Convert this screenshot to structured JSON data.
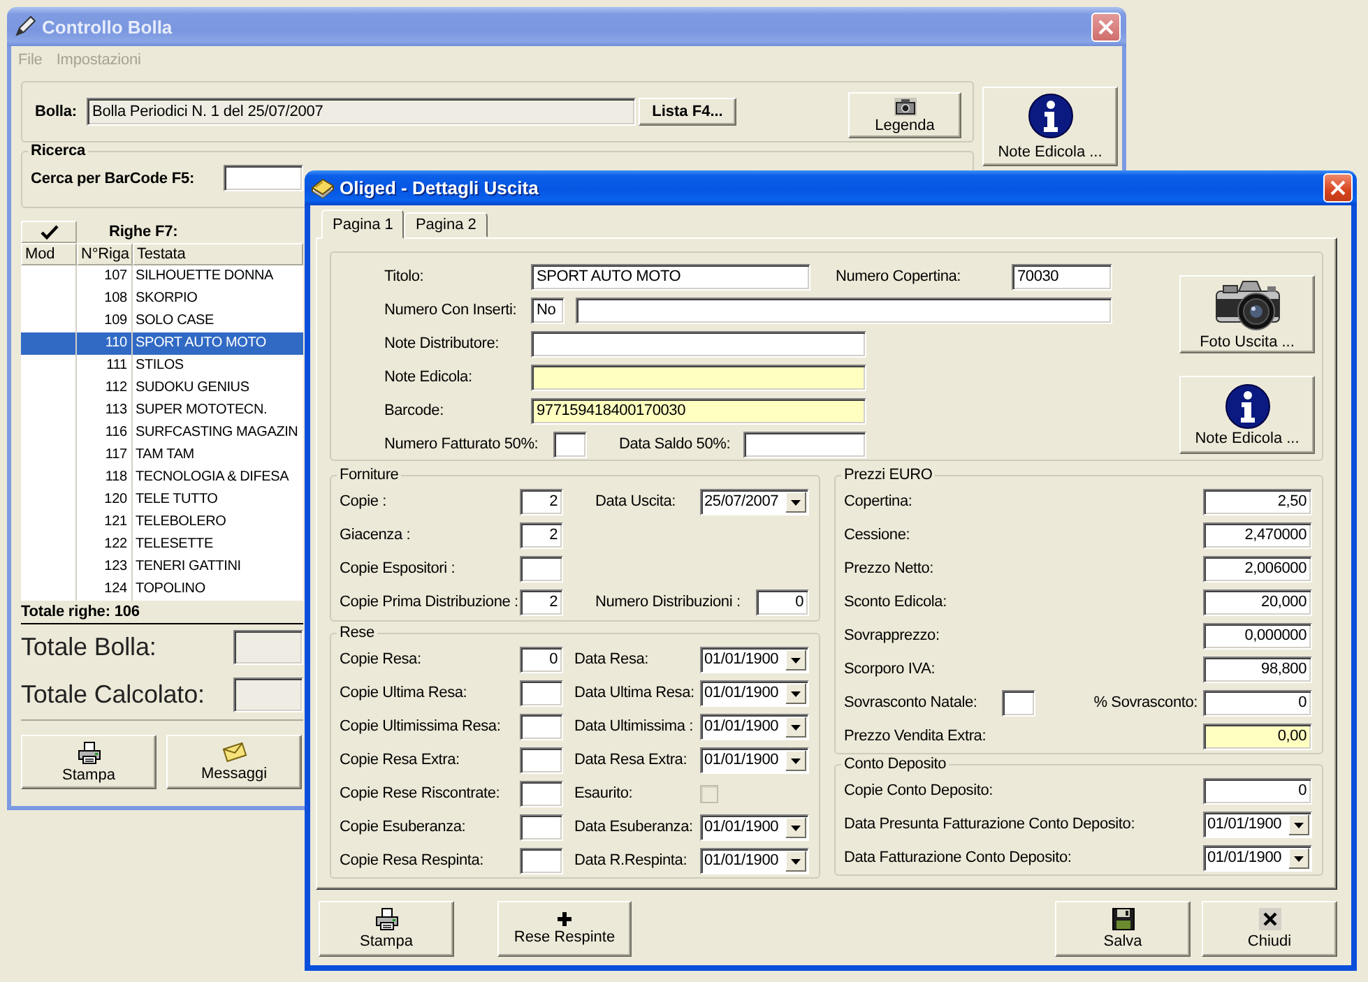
{
  "background_window": {
    "title": "Controllo Bolla",
    "menu": [
      {
        "label": "File",
        "disabled": true
      },
      {
        "label": "Impostazioni",
        "disabled": true
      }
    ],
    "bolla": {
      "label": "Bolla:",
      "value": "Bolla Periodici N. 1 del 25/07/2007",
      "button": "Lista F4..."
    },
    "legend_button": {
      "label": "Legenda"
    },
    "notes_button": {
      "label": "Note Edicola ..."
    },
    "search": {
      "title": "Ricerca",
      "label": "Cerca per BarCode F5:"
    },
    "rows_title": "Righe F7:",
    "table": {
      "columns": [
        "Mod",
        "N°Riga",
        "Testata"
      ],
      "rows": [
        {
          "number": "107",
          "title": "SILHOUETTE DONNA",
          "selected": false
        },
        {
          "number": "108",
          "title": "SKORPIO",
          "selected": false
        },
        {
          "number": "109",
          "title": "SOLO CASE",
          "selected": false
        },
        {
          "number": "110",
          "title": "SPORT AUTO MOTO",
          "selected": true
        },
        {
          "number": "111",
          "title": "STILOS",
          "selected": false
        },
        {
          "number": "112",
          "title": "SUDOKU GENIUS",
          "selected": false
        },
        {
          "number": "113",
          "title": "SUPER MOTOTECN.",
          "selected": false
        },
        {
          "number": "116",
          "title": "SURFCASTING MAGAZIN",
          "selected": false
        },
        {
          "number": "117",
          "title": "TAM TAM",
          "selected": false
        },
        {
          "number": "118",
          "title": "TECNOLOGIA & DIFESA",
          "selected": false
        },
        {
          "number": "120",
          "title": "TELE TUTTO",
          "selected": false
        },
        {
          "number": "121",
          "title": "TELEBOLERO",
          "selected": false
        },
        {
          "number": "122",
          "title": "TELESETTE",
          "selected": false
        },
        {
          "number": "123",
          "title": "TENERI GATTINI",
          "selected": false
        },
        {
          "number": "124",
          "title": "TOPOLINO",
          "selected": false
        }
      ]
    },
    "total_rows": "Totale righe: 106",
    "totals": [
      {
        "label": "Totale Bolla:"
      },
      {
        "label": "Totale Calcolato:"
      }
    ],
    "buttons": [
      {
        "label": "Stampa"
      },
      {
        "label": "Messaggi"
      }
    ]
  },
  "detail_window": {
    "title": "Oliged - Dettagli Uscita",
    "tabs": [
      {
        "label": "Pagina 1",
        "selected": true
      },
      {
        "label": "Pagina 2",
        "selected": false
      }
    ],
    "header": {
      "titolo": {
        "label": "Titolo:",
        "value": "SPORT AUTO MOTO",
        "highlighted": false
      },
      "numero_copertina": {
        "label": "Numero Copertina:",
        "value": "70030",
        "highlighted": false
      },
      "numero_con_inserti": {
        "label": "Numero Con Inserti:",
        "value": "No",
        "highlighted": false
      },
      "inserti_note": {
        "highlighted": false
      },
      "note_distributore": {
        "label": "Note Distributore:",
        "highlighted": false
      },
      "note_edicola": {
        "label": "Note Edicola:",
        "highlighted": true
      },
      "barcode": {
        "label": "Barcode:",
        "value": "977159418400170030",
        "highlighted": true
      },
      "numero_fatturato": {
        "label": "Numero Fatturato 50%:",
        "highlighted": false
      },
      "data_saldo": {
        "label": "Data Saldo 50%:",
        "highlighted": false
      }
    },
    "side_buttons": [
      {
        "label": "Foto Uscita ..."
      },
      {
        "label": "Note Edicola ..."
      }
    ],
    "forniture": {
      "title": "Forniture",
      "rows": [
        {
          "label": "Copie :",
          "value": "2",
          "side": {
            "kind": "date",
            "label": "Data Uscita:",
            "value": "25/07/2007"
          }
        },
        {
          "label": "Giacenza :",
          "value": "2"
        },
        {
          "label": "Copie Espositori :"
        },
        {
          "label": "Copie Prima Distribuzione :",
          "value": "2",
          "side": {
            "kind": "number",
            "label": "Numero Distribuzioni :",
            "value": "0"
          }
        }
      ]
    },
    "rese": {
      "title": "Rese",
      "rows": [
        {
          "label": "Copie Resa:",
          "value": "0",
          "side": {
            "kind": "date",
            "label": "Data Resa:",
            "value": "01/01/1900"
          }
        },
        {
          "label": "Copie Ultima Resa:",
          "side": {
            "kind": "date",
            "label": "Data Ultima Resa:",
            "value": "01/01/1900"
          }
        },
        {
          "label": "Copie Ultimissima Resa:",
          "side": {
            "kind": "date",
            "label": "Data Ultimissima :",
            "value": "01/01/1900"
          }
        },
        {
          "label": "Copie Resa Extra:",
          "side": {
            "kind": "date",
            "label": "Data Resa Extra:",
            "value": "01/01/1900"
          }
        },
        {
          "label": "Copie Rese Riscontrate:",
          "side": {
            "kind": "checkbox",
            "label": "Esaurito:",
            "checked": false,
            "disabled": true
          }
        },
        {
          "label": "Copie Esuberanza:",
          "side": {
            "kind": "date",
            "label": "Data Esuberanza:",
            "value": "01/01/1900"
          }
        },
        {
          "label": "Copie Resa Respinta:",
          "side": {
            "kind": "date",
            "label": "Data R.Respinta:",
            "value": "01/01/1900"
          }
        }
      ]
    },
    "prezzi": {
      "title": "Prezzi EURO",
      "rows": [
        {
          "kind": "number",
          "label": "Copertina:",
          "value": "2,50",
          "highlighted": false
        },
        {
          "kind": "number",
          "label": "Cessione:",
          "value": "2,470000",
          "highlighted": false
        },
        {
          "kind": "number",
          "label": "Prezzo Netto:",
          "value": "2,006000",
          "highlighted": false
        },
        {
          "kind": "number",
          "label": "Sconto Edicola:",
          "value": "20,000",
          "highlighted": false
        },
        {
          "kind": "number",
          "label": "Sovrapprezzo:",
          "value": "0,000000",
          "highlighted": false
        },
        {
          "kind": "number",
          "label": "Scorporo IVA:",
          "value": "98,800",
          "highlighted": false
        },
        {
          "kind": "split",
          "label": "Sovrasconto Natale:",
          "side": {
            "label": "% Sovrasconto:",
            "value": "0",
            "highlighted": false
          }
        },
        {
          "kind": "number",
          "label": "Prezzo Vendita Extra:",
          "value": "0,00",
          "highlighted": true
        }
      ]
    },
    "conto_deposito": {
      "title": "Conto Deposito",
      "rows": [
        {
          "kind": "number",
          "label": "Copie Conto Deposito:",
          "value": "0",
          "highlighted": false
        },
        {
          "kind": "date",
          "label": "Data Presunta Fatturazione Conto Deposito:",
          "value": "01/01/1900"
        },
        {
          "kind": "date",
          "label": "Data Fatturazione Conto Deposito:",
          "value": "01/01/1900"
        }
      ]
    },
    "buttons_left": [
      {
        "label": "Stampa"
      },
      {
        "label": "Rese Respinte"
      }
    ],
    "buttons_right": [
      {
        "label": "Salva"
      },
      {
        "label": "Chiudi"
      }
    ]
  }
}
